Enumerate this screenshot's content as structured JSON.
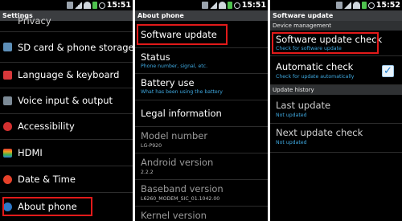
{
  "status_bar": {
    "screen1_time": "15:51",
    "screen2_time": "15:51",
    "screen3_time": "15:52",
    "icons": [
      "usb-icon",
      "signal-icon",
      "wifi-icon",
      "battery-icon",
      "alarm-icon"
    ]
  },
  "settings": {
    "title": "Settings",
    "partial_top": "Privacy",
    "items": [
      {
        "label": "SD card & phone storage",
        "icon": "sd-card-icon"
      },
      {
        "label": "Language & keyboard",
        "icon": "language-icon"
      },
      {
        "label": "Voice input & output",
        "icon": "voice-icon"
      },
      {
        "label": "Accessibility",
        "icon": "accessibility-icon"
      },
      {
        "label": "HDMI",
        "icon": "hdmi-icon"
      },
      {
        "label": "Date & Time",
        "icon": "clock-icon"
      },
      {
        "label": "About phone",
        "icon": "info-icon"
      }
    ]
  },
  "about": {
    "title": "About phone",
    "items": [
      {
        "label": "Software update",
        "sub": ""
      },
      {
        "label": "Status",
        "sub": "Phone number, signal, etc."
      },
      {
        "label": "Battery use",
        "sub": "What has been using the battery"
      },
      {
        "label": "Legal information",
        "sub": ""
      },
      {
        "label": "Model number",
        "sub": "LG-P920"
      },
      {
        "label": "Android version",
        "sub": "2.2.2"
      },
      {
        "label": "Baseband version",
        "sub": "L6260_MODEM_SIC_01.1042.00"
      },
      {
        "label": "Kernel version",
        "sub": ""
      }
    ]
  },
  "update": {
    "title": "Software update",
    "section_device": "Device management",
    "check_label": "Software update check",
    "check_sub": "Check for software update",
    "auto_label": "Automatic check",
    "auto_sub": "Check for update automatically",
    "auto_checked": true,
    "check_mark": "✓",
    "section_history": "Update history",
    "last_label": "Last update",
    "last_sub": "Not updated",
    "next_label": "Next update check",
    "next_sub": "Not updated"
  },
  "colors": {
    "highlight": "#e21a1a",
    "subtitle_blue": "#3fa9e0",
    "title_bar": "#3b3d40"
  }
}
